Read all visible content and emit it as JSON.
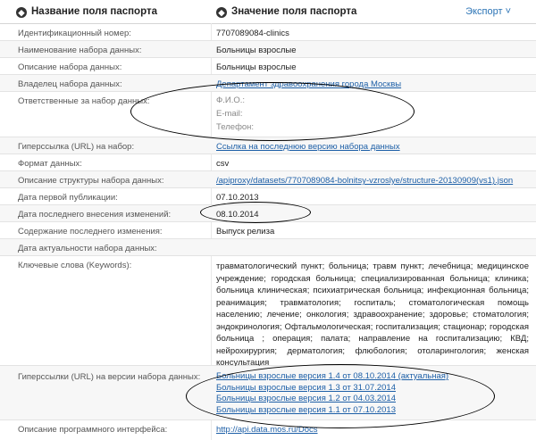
{
  "header": {
    "col1": "Название поля паспорта",
    "col2": "Значение поля паспорта",
    "export": "Экспорт",
    "export_arrow": "˅"
  },
  "rows": {
    "id": {
      "label": "Идентификационный номер:",
      "value": "7707089084-clinics"
    },
    "name": {
      "label": "Наименование набора данных:",
      "value": "Больницы взрослые"
    },
    "desc": {
      "label": "Описание набора данных:",
      "value": "Больницы взрослые"
    },
    "owner": {
      "label": "Владелец набора данных:",
      "value": "Департамент здравоохранения города Москвы"
    },
    "resp": {
      "label": "Ответственные за набор данных:",
      "fio": "Ф.И.О.:",
      "email": "E-mail:",
      "phone": "Телефон:"
    },
    "url": {
      "label": "Гиперссылка (URL) на набор:",
      "value": "Ссылка на последнюю версию набора данных"
    },
    "format": {
      "label": "Формат данных:",
      "value": "csv"
    },
    "structure": {
      "label": "Описание структуры набора данных:",
      "value": "/apiproxy/datasets/7707089084-bolnitsy-vzroslye/structure-20130909(vs1).json"
    },
    "first_pub": {
      "label": "Дата первой публикации:",
      "value": "07.10.2013"
    },
    "last_change": {
      "label": "Дата последнего внесения изменений:",
      "value": "08.10.2014"
    },
    "content": {
      "label": "Содержание последнего изменения:",
      "value": "Выпуск релиза"
    },
    "actual": {
      "label": "Дата актуальности набора данных:",
      "value": ""
    },
    "keywords": {
      "label": "Ключевые слова (Keywords):",
      "value": "травматологический пункт; больница; травм пункт; лечебница; медицинское учреждение; городская больница; специализированная больница; клиника; больница клиническая; психиатрическая больница; инфекционная больница; реанимация; травматология; госпиталь; стоматологическая помощь населению; лечение; онкология; здравоохранение; здоровье; стоматология; эндокринология; Офтальмологическая; госпитализация; стационар; городская больница ; операция; палата; направление на госпитализацию; КВД; нейрохирургия; дерматология; флюбология; отоларингология; женская консультация"
    },
    "versions": {
      "label": "Гиперссылки (URL) на версии набора данных:",
      "links": [
        "Больницы взрослые версия 1.4 от 08.10.2014 (актуальная)",
        "Больницы взрослые версия 1.3 от 31.07.2014",
        "Больницы взрослые версия 1.2 от 04.03.2014",
        "Больницы взрослые версия 1.1 от 07.10.2013"
      ]
    },
    "api": {
      "label": "Описание программного интерфейса:",
      "value": "http://api.data.mos.ru/Docs"
    }
  }
}
